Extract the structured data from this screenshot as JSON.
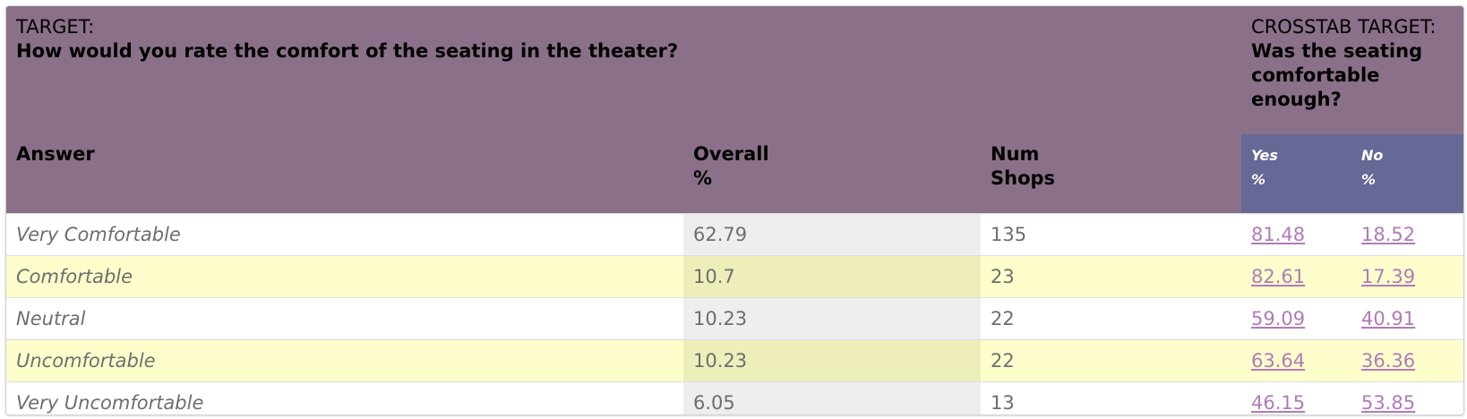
{
  "header": {
    "target_label": "TARGET:",
    "target_question": "How would you rate the comfort of the seating in the theater?",
    "crosstab_label": "CROSSTAB TARGET:",
    "crosstab_question": "Was the seating comfortable enough?"
  },
  "columns": {
    "answer": "Answer",
    "overall_line1": "Overall",
    "overall_line2": "%",
    "num_line1": "Num",
    "num_line2": "Shops",
    "yes_line1": "Yes",
    "yes_line2": "%",
    "no_line1": "No",
    "no_line2": "%"
  },
  "rows": [
    {
      "answer": "Very Comfortable",
      "overall": "62.79",
      "num": "135",
      "yes": "81.48",
      "no": "18.52"
    },
    {
      "answer": "Comfortable",
      "overall": "10.7",
      "num": "23",
      "yes": "82.61",
      "no": "17.39"
    },
    {
      "answer": "Neutral",
      "overall": "10.23",
      "num": "22",
      "yes": "59.09",
      "no": "40.91"
    },
    {
      "answer": "Uncomfortable",
      "overall": "10.23",
      "num": "22",
      "yes": "63.64",
      "no": "36.36"
    },
    {
      "answer": "Very Uncomfortable",
      "overall": "6.05",
      "num": "13",
      "yes": "46.15",
      "no": "53.85"
    }
  ],
  "colors": {
    "header_bg": "#8a7088",
    "crosstab_sub_bg": "#666895",
    "alt_row_bg": "#fefecc",
    "link_color": "#b07bb8"
  }
}
